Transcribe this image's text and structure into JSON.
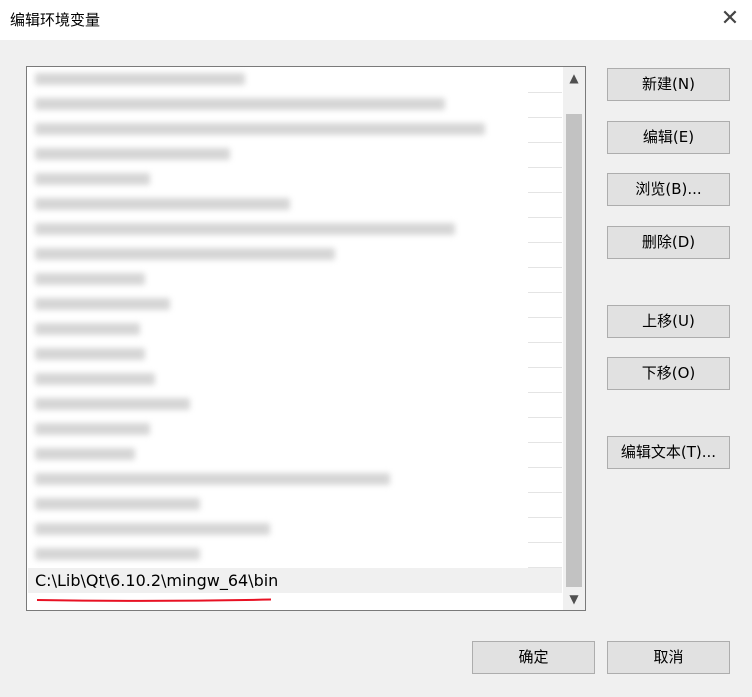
{
  "window": {
    "title": "编辑环境变量",
    "close_glyph": "✕"
  },
  "list": {
    "blurred_row_count": 20,
    "selected_value": "C:\\Lib\\Qt\\6.10.2\\mingw_64\\bin",
    "underline_color": "#e81123"
  },
  "scrollbar": {
    "up_glyph": "▲",
    "down_glyph": "▼"
  },
  "buttons": {
    "new_label": "新建(N)",
    "edit_label": "编辑(E)",
    "browse_label": "浏览(B)...",
    "delete_label": "删除(D)",
    "move_up_label": "上移(U)",
    "move_down_label": "下移(O)",
    "edit_text_label": "编辑文本(T)...",
    "ok_label": "确定",
    "cancel_label": "取消"
  }
}
